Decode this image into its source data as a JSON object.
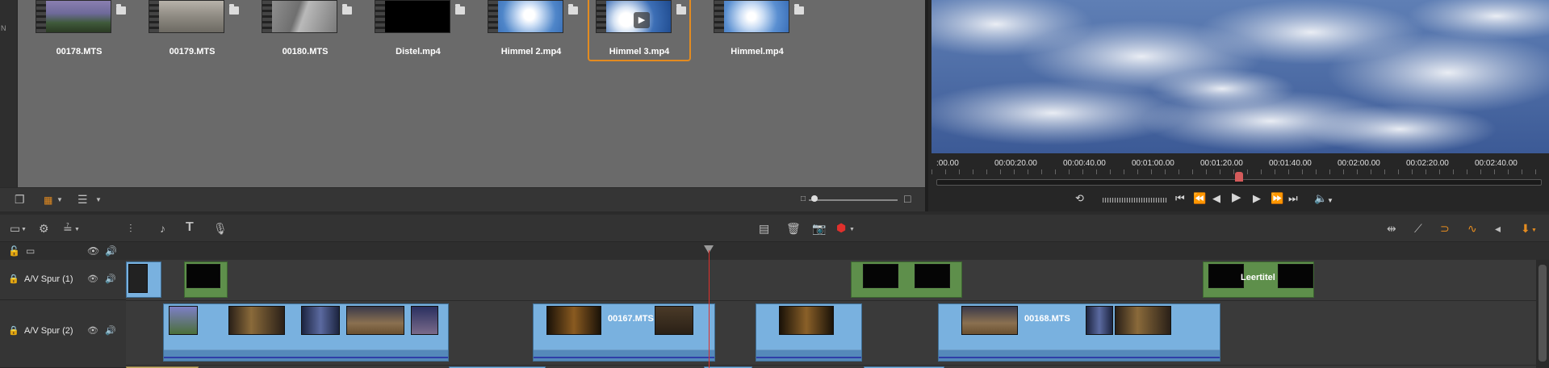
{
  "library": {
    "side_label": "N",
    "assets": [
      {
        "name": "00178.MTS",
        "selected": false
      },
      {
        "name": "00179.MTS",
        "selected": false
      },
      {
        "name": "00180.MTS",
        "selected": false
      },
      {
        "name": "Distel.mp4",
        "selected": false
      },
      {
        "name": "Himmel 2.mp4",
        "selected": false
      },
      {
        "name": "Himmel 3.mp4",
        "selected": true
      },
      {
        "name": "Himmel.mp4",
        "selected": false
      }
    ]
  },
  "player": {
    "ruler_labels": [
      ":00.00",
      "00:00:20.00",
      "00:00:40.00",
      "00:01:00.00",
      "00:01:20.00",
      "00:01:40.00",
      "00:02:00.00",
      "00:02:20.00",
      "00:02:40.00"
    ],
    "scrub_position": 0.5
  },
  "timeline": {
    "tracks": [
      {
        "name": "A/V Spur (1)"
      },
      {
        "name": "A/V Spur (2)"
      }
    ],
    "clip_labels": {
      "c00167": "00167.MTS",
      "c00168": "00168.MTS",
      "leertitel": "Leertitel"
    }
  },
  "colors": {
    "accent": "#e38b20",
    "clip_blue": "#79b1df",
    "title_green": "#5e8f4b",
    "playhead": "#e0302c"
  },
  "icons": {
    "media": "film-strip-icon",
    "folder": "folder-icon"
  }
}
